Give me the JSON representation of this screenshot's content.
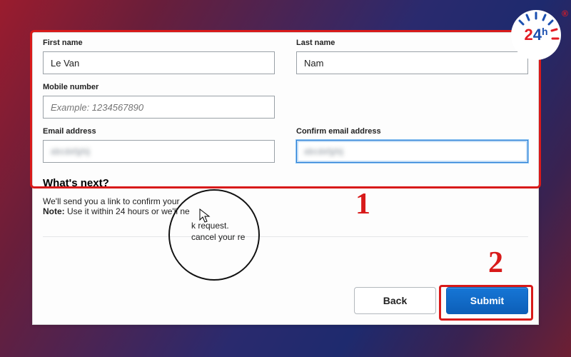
{
  "form": {
    "first_name": {
      "label": "First name",
      "value": "Le Van"
    },
    "last_name": {
      "label": "Last name",
      "value": "Nam"
    },
    "mobile": {
      "label": "Mobile number",
      "placeholder": "Example: 1234567890",
      "value": ""
    },
    "email": {
      "label": "Email address",
      "value": "••••••••••••"
    },
    "confirm_email": {
      "label": "Confirm email address",
      "value": "••••••••••••"
    }
  },
  "whats_next": {
    "title": "What's next?",
    "line1": "We'll send you a link to confirm your",
    "note_prefix": "Note:",
    "note_rest": " Use it within 24 hours or we'll ne"
  },
  "circle_text": {
    "l1": "k request.",
    "l2": "cancel your re"
  },
  "buttons": {
    "back": "Back",
    "submit": "Submit"
  },
  "annotations": {
    "one": "1",
    "two": "2"
  },
  "logo": {
    "two": "2",
    "four": "4",
    "h": "h",
    "reg": "®"
  }
}
